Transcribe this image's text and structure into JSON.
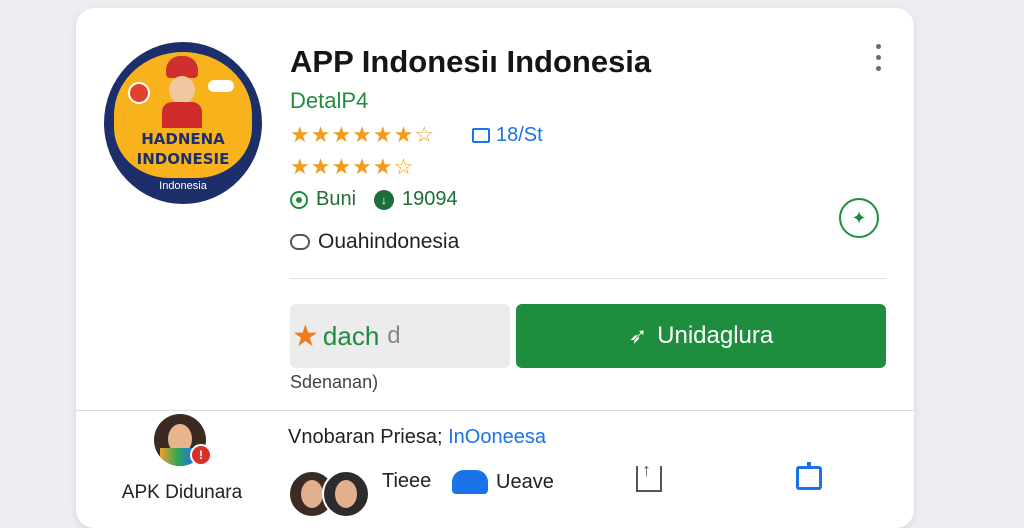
{
  "app": {
    "title": "APP Indonesiı Indonesia",
    "subtitle": "DetalP4",
    "icon": {
      "line1": "HADNENA",
      "line2": "INDONESIE",
      "line3": "Indonesia"
    },
    "meta_badge": "18/St",
    "stats": {
      "label": "Buni",
      "downloads": "19094"
    },
    "chat_label": "Ouahindonesia",
    "rating_row_1": "★★★★★★☆",
    "rating_row_2": "★★★★★☆"
  },
  "actions": {
    "secondary_label": "dach",
    "secondary_suffix": "d",
    "primary_label": "Unidaglura",
    "note": "Sdenanan)"
  },
  "developer": {
    "apk_label": "APK Didunara",
    "line_prefix": "Vnobaran Priesa; ",
    "line_link": "InOoneesa",
    "feature_1": "Tieee",
    "feature_2": "Ueave"
  },
  "colors": {
    "accent_green": "#1e8e3e",
    "star_orange": "#f29b1d",
    "link_blue": "#1a73e8"
  }
}
